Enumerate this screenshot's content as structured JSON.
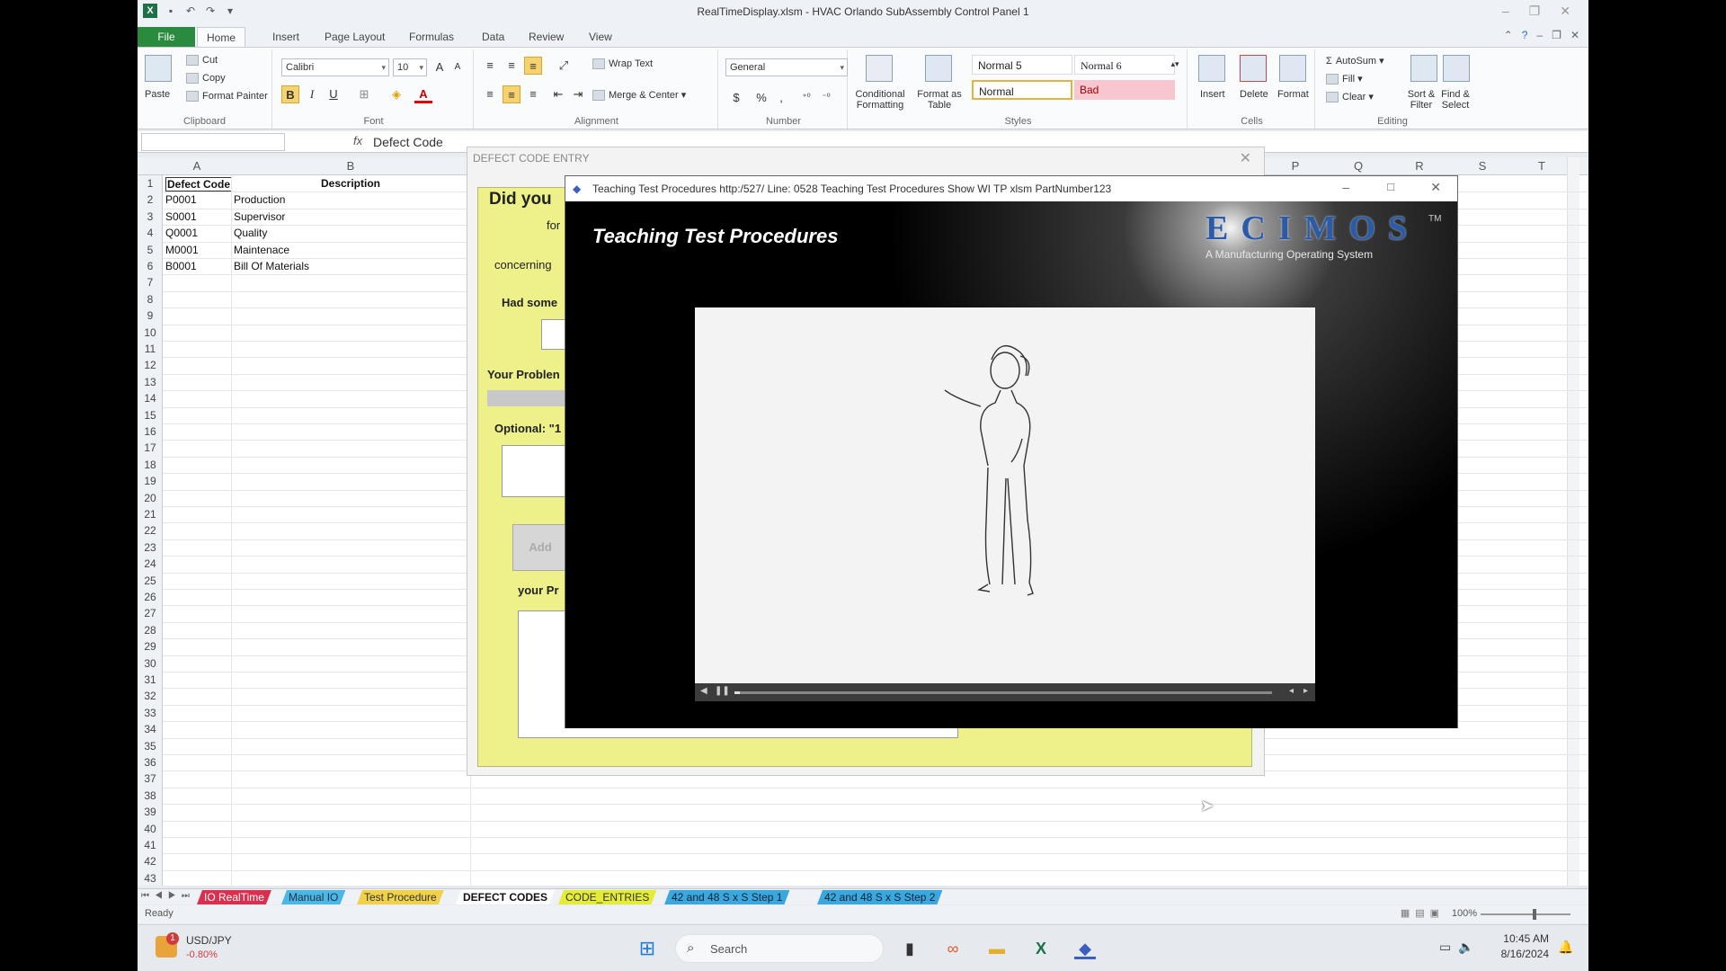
{
  "window": {
    "title": "RealTimeDisplay.xlsm - HVAC Orlando SubAssembly Control Panel 1"
  },
  "ribbon_tabs": [
    "File",
    "Home",
    "Insert",
    "Page Layout",
    "Formulas",
    "Data",
    "Review",
    "View"
  ],
  "clipboard": {
    "paste": "Paste",
    "cut": "Cut",
    "copy": "Copy",
    "format_painter": "Format Painter",
    "label": "Clipboard"
  },
  "font": {
    "name": "Calibri",
    "size": "10",
    "label": "Font"
  },
  "alignment": {
    "wrap_text": "Wrap Text",
    "merge_center": "Merge & Center",
    "label": "Alignment"
  },
  "number": {
    "format": "General",
    "label": "Number",
    "currency": "$",
    "percent": "%",
    "comma": ","
  },
  "styles": {
    "conditional_formatting": "Conditional Formatting",
    "format_as_table": "Format as Table",
    "normal5": "Normal 5",
    "normal6": "Normal 6",
    "normal": "Normal",
    "bad": "Bad",
    "label": "Styles"
  },
  "cells": {
    "insert": "Insert",
    "delete": "Delete",
    "format": "Format",
    "label": "Cells"
  },
  "editing": {
    "autosum": "AutoSum",
    "fill": "Fill",
    "clear": "Clear",
    "sort_filter": "Sort & Filter",
    "find_select": "Find & Select",
    "label": "Editing"
  },
  "formula_bar": {
    "fx": "fx",
    "content": "Defect Code"
  },
  "columns": [
    "A",
    "B",
    "P",
    "Q",
    "R",
    "S",
    "T"
  ],
  "sheet": {
    "header": {
      "a": "Defect Code",
      "b": "Description"
    },
    "rows": [
      {
        "a": "P0001",
        "b": "Production"
      },
      {
        "a": "S0001",
        "b": "Supervisor"
      },
      {
        "a": "Q0001",
        "b": "Quality"
      },
      {
        "a": "M0001",
        "b": "Maintenace"
      },
      {
        "a": "B0001",
        "b": "Bill Of Materials"
      }
    ],
    "row_numbers": [
      "1",
      "2",
      "3",
      "4",
      "5",
      "6",
      "7",
      "8",
      "9",
      "10",
      "11",
      "12",
      "13",
      "14",
      "15",
      "16",
      "17",
      "18",
      "19",
      "20",
      "21",
      "22",
      "23",
      "24",
      "25",
      "26",
      "27",
      "28",
      "29",
      "30",
      "31",
      "32",
      "33",
      "34",
      "35",
      "36",
      "37",
      "38",
      "39",
      "40",
      "41",
      "42",
      "43"
    ]
  },
  "sheet_tabs": [
    {
      "label": "IO RealTime",
      "color": "#d9304f",
      "text": "#fff"
    },
    {
      "label": "Manual IO",
      "color": "#4ab7e6",
      "text": "#234"
    },
    {
      "label": "Test Procedure",
      "color": "#f2d14a",
      "text": "#333"
    },
    {
      "label": "DEFECT CODES",
      "color": "#ffffff",
      "text": "#111"
    },
    {
      "label": "CODE_ENTRIES",
      "color": "#e4ec35",
      "text": "#333"
    },
    {
      "label": "42 and 48 S x S Step 1",
      "color": "#3aa8df",
      "text": "#123"
    },
    {
      "label": "42 and 48 S x S Step 2",
      "color": "#3aa8df",
      "text": "#123"
    }
  ],
  "status": {
    "ready": "Ready",
    "zoom": "100%"
  },
  "defect_dialog": {
    "title": "DEFECT CODE ENTRY",
    "heading": "Did you",
    "for": "for",
    "concerning": "concerning",
    "had_some": "Had some",
    "your_problem": "Your Problen",
    "optional": "Optional: \"1",
    "add_button": "Add",
    "your_pr": "your Pr"
  },
  "media": {
    "titlebar": "Teaching Test Procedures http:/527/ Line: 0528 Teaching Test Procedures Show WI TP xlsm PartNumber123",
    "heading": "Teaching Test Procedures",
    "logo": "ECIMOS",
    "logo_tm": "TM",
    "logo_sub": "A Manufacturing Operating System"
  },
  "taskbar": {
    "ticker": "USD/JPY",
    "change": "-0.80%",
    "badge": "1",
    "search": "Search",
    "time": "10:45 AM",
    "date": "8/16/2024"
  },
  "colors": {
    "excel_green": "#2a8a3e",
    "dialog_yellow": "#eef08a",
    "bad_fill": "#f7c6ce",
    "negative": "#d23b3b"
  }
}
